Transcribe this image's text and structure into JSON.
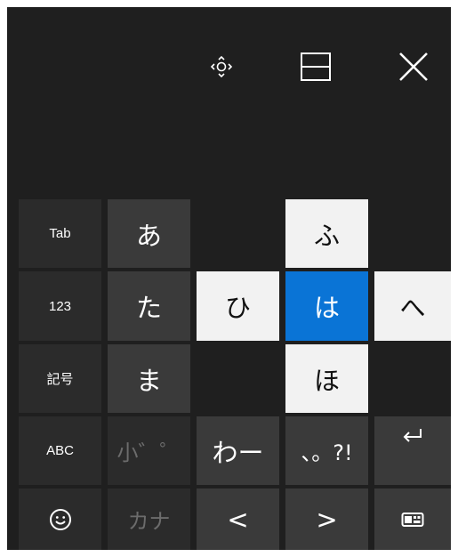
{
  "colors": {
    "panel_bg": "#1f1f1f",
    "accent": "#0a74d6",
    "flick_bg": "#f2f2f2"
  },
  "toolbar": {
    "move_icon": "move-icon",
    "dock_icon": "dock-icon",
    "close_icon": "close-icon"
  },
  "keys": {
    "tab": "Tab",
    "num": "123",
    "symbols": "記号",
    "abc": "ABC",
    "a": "あ",
    "ta": "た",
    "ma": "ま",
    "small": "小゛゜",
    "wa": "わー",
    "punct": "、。?!",
    "kana": "カナ",
    "left": "<",
    "right": ">",
    "emoji_icon": "smiley-icon",
    "enter_icon": "enter-icon",
    "keyboard_icon": "keyboard-icon"
  },
  "flick": {
    "up": "ふ",
    "left": "ひ",
    "center": "は",
    "right": "へ",
    "down": "ほ"
  }
}
